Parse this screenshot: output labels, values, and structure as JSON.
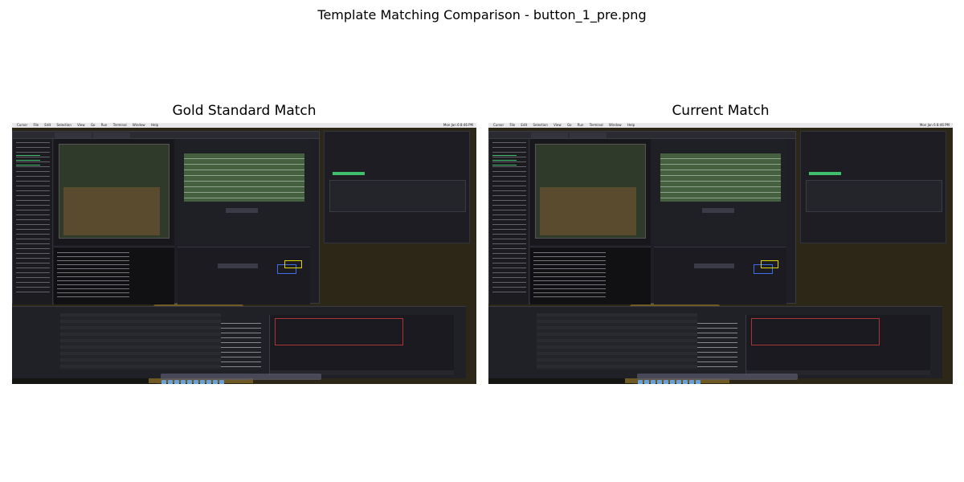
{
  "figure": {
    "title": "Template Matching Comparison - button_1_pre.png"
  },
  "panels": [
    {
      "title": "Gold Standard Match",
      "screenshot": {
        "menu": [
          "Cursor",
          "File",
          "Edit",
          "Selection",
          "View",
          "Go",
          "Run",
          "Terminal",
          "Window",
          "Help"
        ],
        "clock": "Mon Jan 6 8:46 PM"
      }
    },
    {
      "title": "Current Match",
      "screenshot": {
        "menu": [
          "Cursor",
          "File",
          "Edit",
          "Selection",
          "View",
          "Go",
          "Run",
          "Terminal",
          "Window",
          "Help"
        ],
        "clock": "Mon Jan 6 8:46 PM"
      }
    }
  ],
  "colors": {
    "match_box": "#e0d400",
    "match_outline": "#3d6ee8",
    "code_highlight": "#44603f"
  }
}
